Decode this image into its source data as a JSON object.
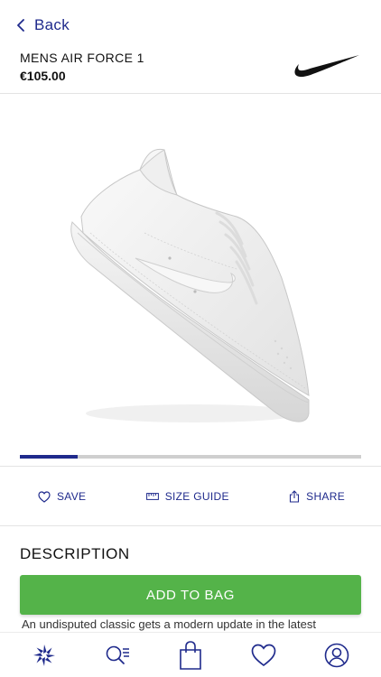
{
  "nav": {
    "back_label": "Back"
  },
  "product": {
    "name": "MENS AIR FORCE 1",
    "price": "€105.00",
    "brand_logo": "nike-swoosh-icon"
  },
  "gallery": {
    "progress": 0.17
  },
  "actions": {
    "save": {
      "label": "SAVE",
      "icon": "heart-icon"
    },
    "size_guide": {
      "label": "SIZE GUIDE",
      "icon": "ruler-icon"
    },
    "share": {
      "label": "SHARE",
      "icon": "share-icon"
    }
  },
  "description": {
    "title": "DESCRIPTION",
    "text": "An undisputed classic gets a modern update in the latest"
  },
  "add_to_bag": {
    "label": "ADD TO BAG"
  },
  "tabbar": {
    "items": [
      {
        "name": "home",
        "icon": "brand-star-icon"
      },
      {
        "name": "search",
        "icon": "search-list-icon"
      },
      {
        "name": "bag",
        "icon": "shopping-bag-icon"
      },
      {
        "name": "wishlist",
        "icon": "heart-icon"
      },
      {
        "name": "account",
        "icon": "user-circle-icon"
      }
    ]
  },
  "colors": {
    "accent": "#1f2a8c",
    "button": "#54b349",
    "divider": "#e3e3e3"
  }
}
